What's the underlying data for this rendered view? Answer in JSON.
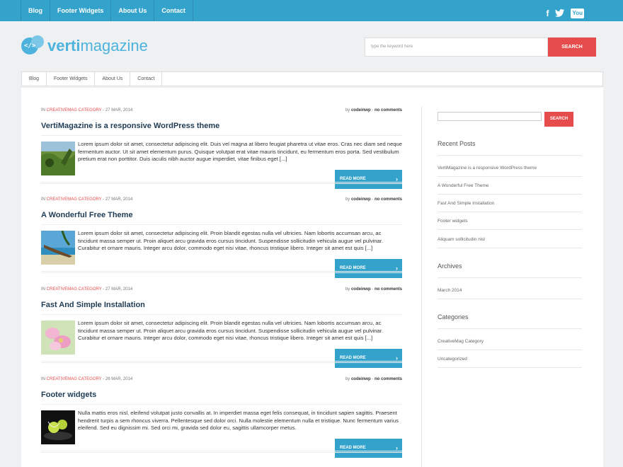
{
  "topnav": {
    "items": [
      "Blog",
      "Footer Widgets",
      "About Us",
      "Contact"
    ]
  },
  "social": {
    "facebook": "f",
    "twitter": "t",
    "youtube": "You"
  },
  "logo": {
    "code": "</>",
    "part1": "verti",
    "part2": "magazine"
  },
  "search": {
    "placeholder": "type the keyword here",
    "button": "SEARCH"
  },
  "subnav": {
    "items": [
      "Blog",
      "Footer Widgets",
      "About Us",
      "Contact"
    ]
  },
  "posts": [
    {
      "meta_prefix": "IN",
      "category": "CREATIVEMAG CATEGORY",
      "date": " - 27 MAR, 2014",
      "by": "by ",
      "author": "codeinwp",
      "comments": "no comments",
      "title": "VertiMagazine is a responsive WordPress theme",
      "excerpt": "Lorem ipsum dolor sit amet, consectetur adipiscing elit. Duis vel magna at libero feugiat pharetra ut vitae eros. Cras nec diam sed neque fermentum auctor. Ut sit amet elementum purus. Quisque volutpat erat vitae mauris tincidunt, eu fermentum eros porta. Sed vestibulum pretium erat non porttitor. Duis iaculis nibh auctor augue imperdiet, vitae finibus eget [...]",
      "readmore": "READ MORE"
    },
    {
      "meta_prefix": "IN",
      "category": "CREATIVEMAG CATEGORY",
      "date": " - 27 MAR, 2014",
      "by": "by ",
      "author": "codeinwp",
      "comments": "no comments",
      "title": "A Wonderful Free Theme",
      "excerpt": "Lorem ipsum dolor sit amet, consectetur adipiscing elit. Proin blandit egestas nulla vel ultricies. Nam lobortis accumsan arcu, ac tincidunt massa semper ut. Proin aliquet arcu gravida eros cursus tincidunt. Suspendisse sollicitudin vehicula augue vel pulvinar. Curabitur et ornare mauris. Integer arcu dolor, commodo eget nisi vitae, rhoncus tristique libero. Integer sit amet est quis [...]",
      "readmore": "READ MORE"
    },
    {
      "meta_prefix": "IN",
      "category": "CREATIVEMAG CATEGORY",
      "date": " - 27 MAR, 2014",
      "by": "by ",
      "author": "codeinwp",
      "comments": "no comments",
      "title": "Fast And Simple Installation",
      "excerpt": "Lorem ipsum dolor sit amet, consectetur adipiscing elit. Proin blandit egestas nulla vel ultricies. Nam lobortis accumsan arcu, ac tincidunt massa semper ut. Proin aliquet arcu gravida eros cursus tincidunt. Suspendisse sollicitudin vehicula augue vel pulvinar. Curabitur et ornare mauris. Integer arcu dolor, commodo eget nisi vitae, rhoncus tristique libero. Integer sit amet est quis [...]",
      "readmore": "READ MORE"
    },
    {
      "meta_prefix": "IN",
      "category": "CREATIVEMAG CATEGORY",
      "date": " - 26 MAR, 2014",
      "by": "by ",
      "author": "codeinwp",
      "comments": "no comments",
      "title": "Footer widgets",
      "excerpt": "Nulla mattis eros nisl, eleifend volutpat justo convallis at. In imperdiet massa eget felis consequat, in tincidunt sapien sagittis. Praesent hendrerit turpis a sem rhoncus viverra. Pellentesque sed dolor orci. Nulla molestie elementum nulla et tristique. Nunc fermentum varius eleifend. Sed eu dignissim mi. Sed orci mi, gravida sed dolor eu, sagittis ullamcorper metus.",
      "readmore": "READ MORE"
    }
  ],
  "sidebar": {
    "search_button": "SEARCH",
    "recent_title": "Recent Posts",
    "recent": [
      "VertiMagazine is a responsive WordPress theme",
      "A Wonderful Free Theme",
      "Fast And Simple Installation",
      "Footer widgets",
      "Aliquam sollicitudin nisl"
    ],
    "archives_title": "Archives",
    "archives": [
      "March 2014"
    ],
    "categories_title": "Categories",
    "categories": [
      "CreativeMag Category",
      "Uncategorized"
    ]
  },
  "colors": {
    "accent": "#34a3cc",
    "button_red": "#e74c4c",
    "title": "#1f3c54"
  }
}
